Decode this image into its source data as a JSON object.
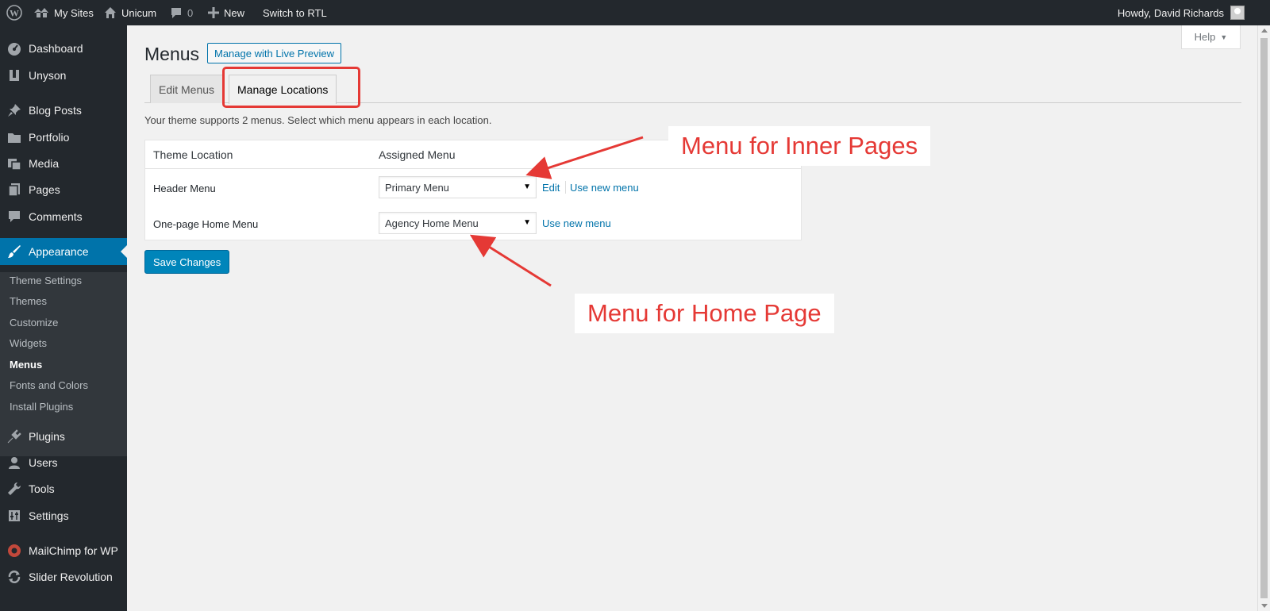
{
  "adminbar": {
    "my_sites": "My Sites",
    "site_name": "Unicum",
    "comments_count": "0",
    "new_label": "New",
    "rtl_label": "Switch to RTL",
    "howdy": "Howdy, David Richards"
  },
  "sidebar": {
    "dashboard": "Dashboard",
    "unyson": "Unyson",
    "blog_posts": "Blog Posts",
    "portfolio": "Portfolio",
    "media": "Media",
    "pages": "Pages",
    "comments": "Comments",
    "appearance": "Appearance",
    "plugins": "Plugins",
    "users": "Users",
    "tools": "Tools",
    "settings": "Settings",
    "mailchimp": "MailChimp for WP",
    "slider": "Slider Revolution",
    "submenu": {
      "theme_settings": "Theme Settings",
      "themes": "Themes",
      "customize": "Customize",
      "widgets": "Widgets",
      "menus": "Menus",
      "fonts_colors": "Fonts and Colors",
      "install_plugins": "Install Plugins"
    }
  },
  "main": {
    "title": "Menus",
    "live_preview": "Manage with Live Preview",
    "help": "Help",
    "tab_edit": "Edit Menus",
    "tab_locations": "Manage Locations",
    "description": "Your theme supports 2 menus. Select which menu appears in each location.",
    "table": {
      "col_location": "Theme Location",
      "col_assigned": "Assigned Menu",
      "rows": [
        {
          "location": "Header Menu",
          "menu": "Primary Menu",
          "edit": "Edit",
          "use_new": "Use new menu"
        },
        {
          "location": "One-page Home Menu",
          "menu": "Agency Home Menu",
          "use_new": "Use new menu"
        }
      ]
    },
    "save": "Save Changes"
  },
  "annotations": {
    "inner_pages": "Menu for Inner Pages",
    "home_page": "Menu for Home Page",
    "color": "#e53935"
  }
}
